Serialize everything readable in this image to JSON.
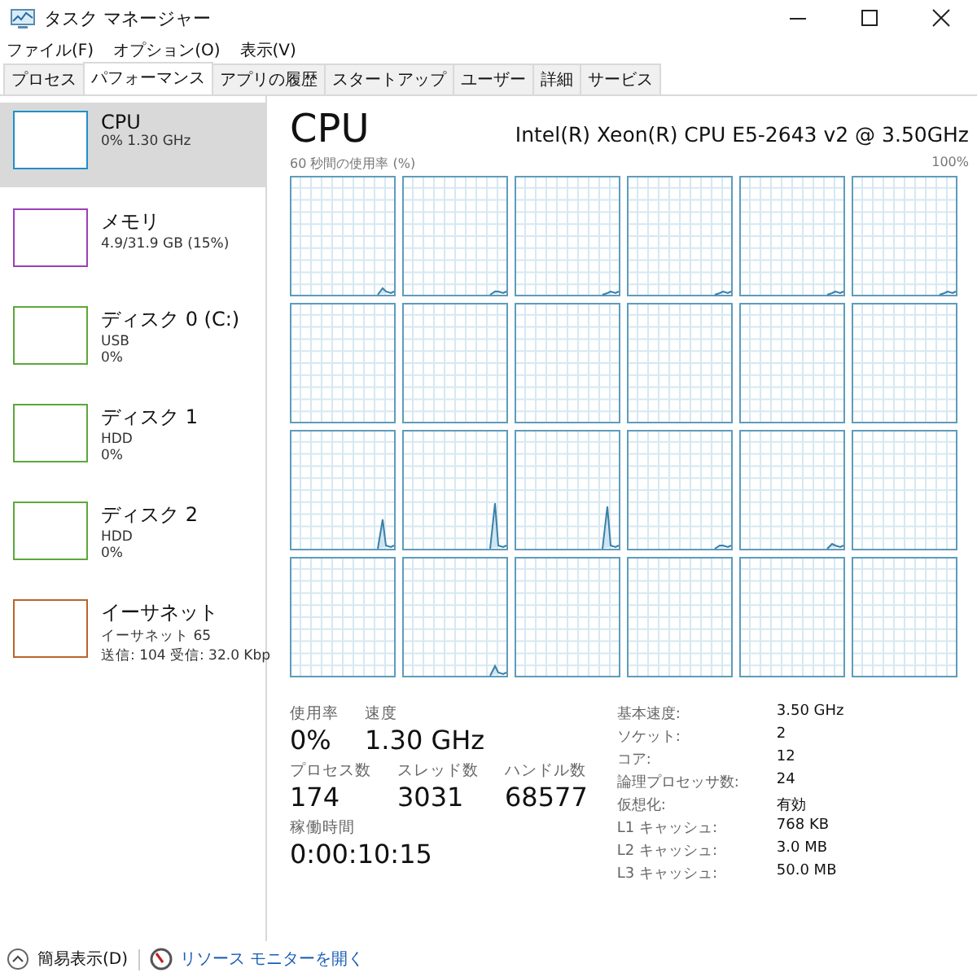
{
  "window": {
    "title": "タスク マネージャー"
  },
  "menu": [
    "ファイル(F)",
    "オプション(O)",
    "表示(V)"
  ],
  "tabs": [
    {
      "label": "プロセス",
      "selected": false
    },
    {
      "label": "パフォーマンス",
      "selected": true
    },
    {
      "label": "アプリの履歴",
      "selected": false
    },
    {
      "label": "スタートアップ",
      "selected": false
    },
    {
      "label": "ユーザー",
      "selected": false
    },
    {
      "label": "詳細",
      "selected": false
    },
    {
      "label": "サービス",
      "selected": false
    }
  ],
  "sidebar": {
    "items": [
      {
        "name": "CPU",
        "details": [
          "0% 1.30 GHz"
        ],
        "color": "#1e90c8",
        "selected": true
      },
      {
        "name": "メモリ",
        "details": [
          "4.9/31.9 GB (15%)"
        ],
        "color": "#9c3fb8",
        "selected": false
      },
      {
        "name": "ディスク 0 (C:)",
        "details": [
          "USB",
          "0%"
        ],
        "color": "#5ba83a",
        "selected": false
      },
      {
        "name": "ディスク 1",
        "details": [
          "HDD",
          "0%"
        ],
        "color": "#5ba83a",
        "selected": false
      },
      {
        "name": "ディスク 2",
        "details": [
          "HDD",
          "0%"
        ],
        "color": "#5ba83a",
        "selected": false
      },
      {
        "name": "イーサネット",
        "details": [
          "イーサネット 65",
          "送信: 104 受信: 32.0 Kbp"
        ],
        "color": "#b8652a",
        "selected": false
      }
    ]
  },
  "detail": {
    "title": "CPU",
    "model": "Intel(R) Xeon(R) CPU E5-2643 v2 @ 3.50GHz",
    "graph_label": "60 秒間の使用率 (%)",
    "graph_max": "100%",
    "stat_rows": [
      [
        {
          "label": "使用率",
          "value": "0%"
        },
        {
          "label": "速度",
          "value": "1.30 GHz"
        }
      ],
      [
        {
          "label": "プロセス数",
          "value": "174"
        },
        {
          "label": "スレッド数",
          "value": "3031"
        },
        {
          "label": "ハンドル数",
          "value": "68577"
        }
      ],
      [
        {
          "label": "稼働時間",
          "value": "0:00:10:15"
        }
      ]
    ],
    "specs": [
      {
        "label": "基本速度:",
        "value": "3.50 GHz"
      },
      {
        "label": "ソケット:",
        "value": "2"
      },
      {
        "label": "コア:",
        "value": "12"
      },
      {
        "label": "論理プロセッサ数:",
        "value": "24"
      },
      {
        "label": "仮想化:",
        "value": "有効"
      },
      {
        "label": "L1 キャッシュ:",
        "value": "768 KB"
      },
      {
        "label": "L2 キャッシュ:",
        "value": "3.0 MB"
      },
      {
        "label": "L3 キャッシュ:",
        "value": "50.0 MB"
      }
    ]
  },
  "footer": {
    "fewer_details": "簡易表示(D)",
    "resource_monitor": "リソース モニターを開く"
  }
}
